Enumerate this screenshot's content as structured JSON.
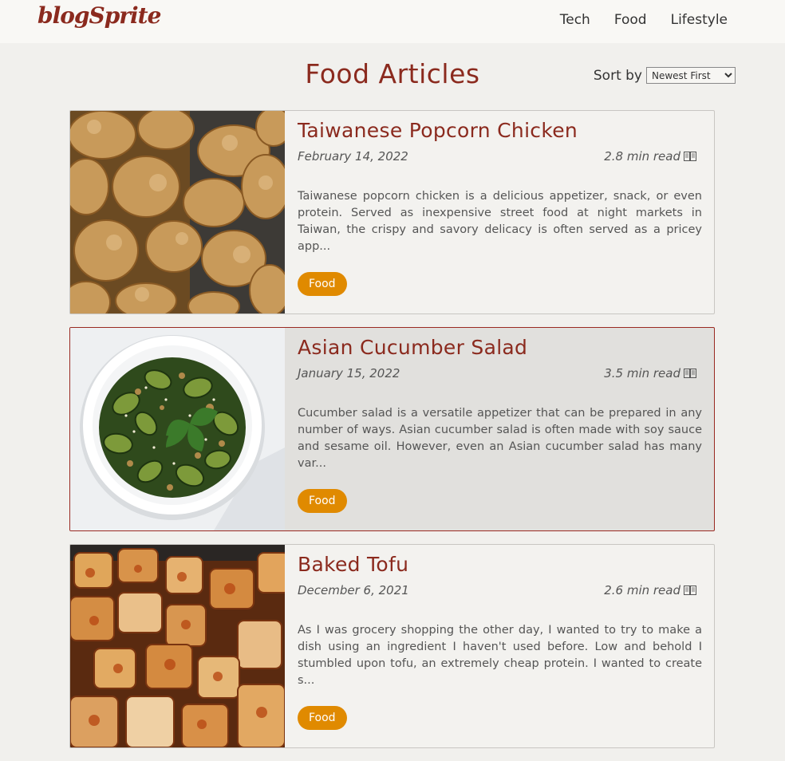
{
  "header": {
    "logo": "blogSprite",
    "nav": [
      "Tech",
      "Food",
      "Lifestyle"
    ]
  },
  "main": {
    "title": "Food Articles",
    "sort": {
      "label": "Sort by",
      "selected": "Newest First"
    }
  },
  "articles": [
    {
      "title": "Taiwanese Popcorn Chicken",
      "date": "February 14, 2022",
      "read_time": "2.8 min read",
      "excerpt": "Taiwanese popcorn chicken is a delicious appetizer, snack, or even protein. Served as inexpensive street food at night markets in Taiwan, the crispy and savory delicacy is often served as a pricey app...",
      "tag": "Food",
      "image": "popcorn-chicken-photo"
    },
    {
      "title": "Asian Cucumber Salad",
      "date": "January 15, 2022",
      "read_time": "3.5 min read",
      "excerpt": "Cucumber salad is a versatile appetizer that can be prepared in any number of ways. Asian cucumber salad is often made with soy sauce and sesame oil. However, even an Asian cucumber salad has many var...",
      "tag": "Food",
      "image": "cucumber-salad-photo"
    },
    {
      "title": "Baked Tofu",
      "date": "December 6, 2021",
      "read_time": "2.6 min read",
      "excerpt": "As I was grocery shopping the other day, I wanted to try to make a dish using an ingredient I haven't used before. Low and behold I stumbled upon tofu, an extremely cheap protein. I wanted to create s...",
      "tag": "Food",
      "image": "baked-tofu-photo"
    }
  ],
  "colors": {
    "brand": "#8b2a1e",
    "tag": "#e08a00",
    "background": "#f1f0ed",
    "active_border": "#9a2a22"
  },
  "icons": {
    "read_time": "book-icon"
  }
}
